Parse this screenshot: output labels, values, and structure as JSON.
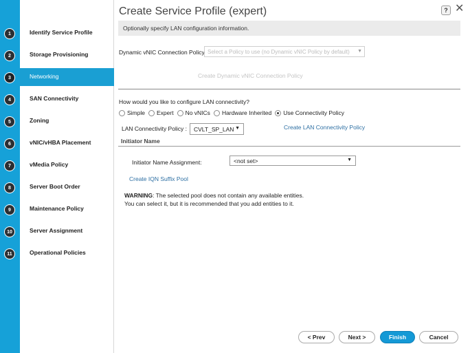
{
  "dialog": {
    "title": "Create Service Profile (expert)",
    "help_label": "?",
    "close_label": "✕",
    "info_text": "Optionally specify LAN configuration information."
  },
  "steps": [
    {
      "num": "1",
      "label": "Identify Service Profile"
    },
    {
      "num": "2",
      "label": "Storage Provisioning"
    },
    {
      "num": "3",
      "label": "Networking",
      "active": true
    },
    {
      "num": "4",
      "label": "SAN Connectivity"
    },
    {
      "num": "5",
      "label": "Zoning"
    },
    {
      "num": "6",
      "label": "vNIC/vHBA Placement"
    },
    {
      "num": "7",
      "label": "vMedia Policy"
    },
    {
      "num": "8",
      "label": "Server Boot Order"
    },
    {
      "num": "9",
      "label": "Maintenance Policy"
    },
    {
      "num": "10",
      "label": "Server Assignment"
    },
    {
      "num": "11",
      "label": "Operational Policies"
    }
  ],
  "dynamic_vnic": {
    "label": "Dynamic vNIC Connection Policy:",
    "select_placeholder": "Select a Policy to use (no Dynamic vNIC Policy by default)",
    "create_link": "Create Dynamic vNIC Connection Policy"
  },
  "lan": {
    "question": "How would you like to configure LAN connectivity?",
    "options": [
      "Simple",
      "Expert",
      "No vNICs",
      "Hardware Inherited",
      "Use Connectivity Policy"
    ],
    "selected": "Use Connectivity Policy",
    "policy_label": "LAN Connectivity Policy :",
    "policy_value": "CVLT_SP_LAN",
    "create_policy_link": "Create LAN Connectivity Policy"
  },
  "initiator": {
    "section_title": "Initiator Name",
    "assignment_label": "Initiator Name Assignment:",
    "assignment_value": "<not set>",
    "create_pool_link": "Create IQN Suffix Pool",
    "warning_bold": "WARNING",
    "warning_line1": ": The selected pool does not contain any available entities.",
    "warning_line2": "You can select it, but it is recommended that you add entities to it."
  },
  "footer": {
    "prev": "< Prev",
    "next": "Next >",
    "finish": "Finish",
    "cancel": "Cancel"
  },
  "colors": {
    "rail": "#16a1d8",
    "active_step": "#1a9fd3",
    "primary_button": "#1499d6",
    "link": "#2d6fa3"
  },
  "icons": {
    "help": "help-icon",
    "close": "close-icon",
    "dropdown": "caret-down-icon"
  }
}
